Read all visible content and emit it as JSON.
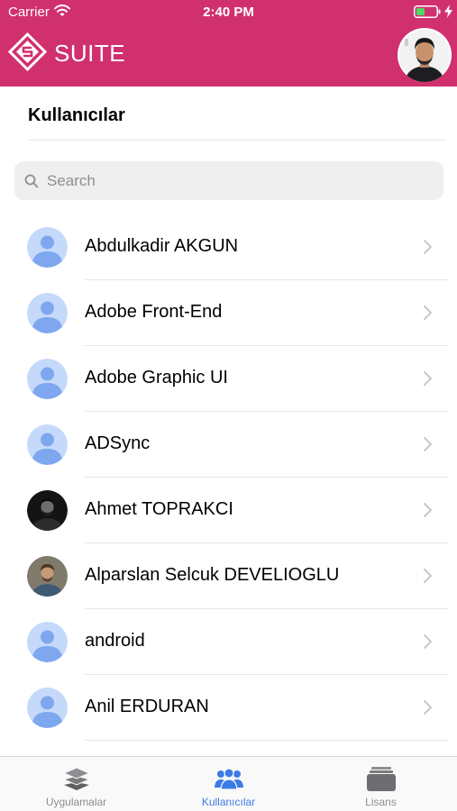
{
  "status_bar": {
    "carrier": "Carrier",
    "time": "2:40 PM"
  },
  "header": {
    "brand": "SUITE"
  },
  "page": {
    "title": "Kullanıcılar"
  },
  "search": {
    "placeholder": "Search"
  },
  "users": [
    {
      "name": "Abdulkadir AKGUN",
      "avatar": "placeholder"
    },
    {
      "name": "Adobe Front-End",
      "avatar": "placeholder"
    },
    {
      "name": "Adobe Graphic UI",
      "avatar": "placeholder"
    },
    {
      "name": "ADSync",
      "avatar": "placeholder"
    },
    {
      "name": "Ahmet TOPRAKCI",
      "avatar": "photo"
    },
    {
      "name": "Alparslan Selcuk DEVELIOGLU",
      "avatar": "photo"
    },
    {
      "name": "android",
      "avatar": "placeholder"
    },
    {
      "name": "Anil ERDURAN",
      "avatar": "placeholder"
    }
  ],
  "tabs": [
    {
      "label": "Uygulamalar",
      "icon": "layers-icon",
      "active": false
    },
    {
      "label": "Kullanıcılar",
      "icon": "users-icon",
      "active": true
    },
    {
      "label": "Lisans",
      "icon": "license-stack-icon",
      "active": false
    }
  ],
  "colors": {
    "brand": "#d1306e",
    "accent": "#3b7be4",
    "avatar_placeholder": "#c5d9fa",
    "avatar_figure": "#7ea7f0"
  }
}
